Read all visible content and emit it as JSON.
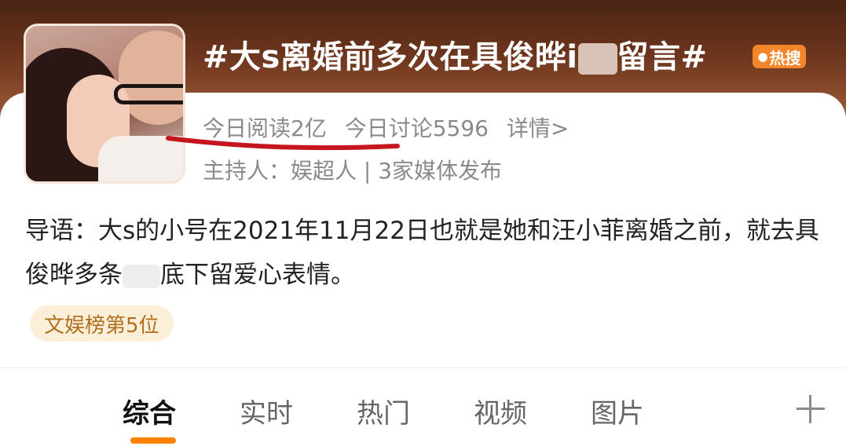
{
  "topic": {
    "title_prefix": "#大s离婚前多次在具俊晔i",
    "title_suffix": "留言#",
    "hot_badge": "热搜",
    "hot_badge_color": "#f3852b"
  },
  "stats": {
    "reads": "今日阅读2亿",
    "discussions": "今日讨论5596",
    "details_link": "详情>"
  },
  "host_line": "主持人：娱超人 | 3家媒体发布",
  "intro": {
    "part1": "导语：大s的小号在2021年11月22日也就是她和汪小菲离婚之前，就去具俊晔多条",
    "part2": "底下留爱心表情。"
  },
  "rank_badge": "文娱榜第5位",
  "tabs": [
    {
      "label": "综合",
      "active": true
    },
    {
      "label": "实时",
      "active": false
    },
    {
      "label": "热门",
      "active": false
    },
    {
      "label": "视频",
      "active": false
    },
    {
      "label": "图片",
      "active": false
    }
  ],
  "accent_color": "#ff8200"
}
